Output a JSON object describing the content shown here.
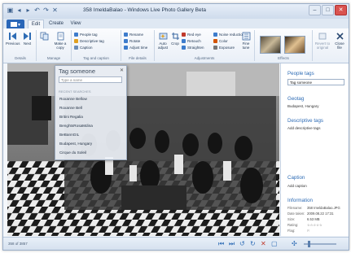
{
  "window": {
    "title": "358 ImeldaBalao - Windows Live Photo Gallery Beta",
    "minimize": "–",
    "maximize": "□",
    "close": "✕"
  },
  "tabs": {
    "file": "",
    "edit": "Edit",
    "create": "Create",
    "view": "View"
  },
  "ribbon": {
    "groups": {
      "details": "Details",
      "manage": "Manage",
      "tag_caption": "Tag and caption",
      "file_details": "File details",
      "adjustments": "Adjustments",
      "effects": "Effects"
    },
    "buttons": {
      "previous": "Previous",
      "next": "Next",
      "make_copy": "Make a copy",
      "people_tag": "People tag",
      "descriptive_tag": "Descriptive tag",
      "caption": "Caption",
      "rename": "Rename",
      "rotate": "Rotate",
      "adjust_time": "Adjust time",
      "auto_adjust": "Auto adjust",
      "crop": "Crop",
      "red_eye": "Red eye",
      "retouch": "Retouch",
      "straighten": "Straighten",
      "noise_reduction": "Noise reduction",
      "color": "Color",
      "exposure": "Exposure",
      "fine_tune": "Fine tune",
      "revert": "Revert to original",
      "close_file": "Close file"
    }
  },
  "tag_popup": {
    "title": "Tag someone",
    "placeholder": "Type a name",
    "section": "RECENT SEARCHES",
    "items": [
      "Roxanne Bellow",
      "Roxanne Bell",
      "Britini Regalia",
      "BenghtsRosaMdina",
      "BeBannGIL",
      "Budapest, Hungary",
      "Cirque du Soleil"
    ]
  },
  "right_panel": {
    "people_tags": {
      "heading": "People tags",
      "value": "Tag someone"
    },
    "geotag": {
      "heading": "Geotag",
      "value": "Budapest, Hungary"
    },
    "descriptive_tags": {
      "heading": "Descriptive tags",
      "add": "Add descriptive tags"
    },
    "caption": {
      "heading": "Caption",
      "add": "Add caption"
    },
    "information": {
      "heading": "Information",
      "rows": [
        {
          "label": "Filename:",
          "value": "358 ImeldaBalao.JPG"
        },
        {
          "label": "Date taken:",
          "value": "2009.08.22  17:31"
        },
        {
          "label": "Size:",
          "value": "6.53 MB"
        },
        {
          "label": "Rating:",
          "value": "☆☆☆☆☆"
        },
        {
          "label": "Flag:",
          "value": "⚐"
        }
      ]
    }
  },
  "status": {
    "text": "358 of 3857"
  },
  "colors": {
    "accent": "#2e6cb5",
    "file_tab": "#2a67b8",
    "ribbon_bg": "#f4f7fb"
  }
}
